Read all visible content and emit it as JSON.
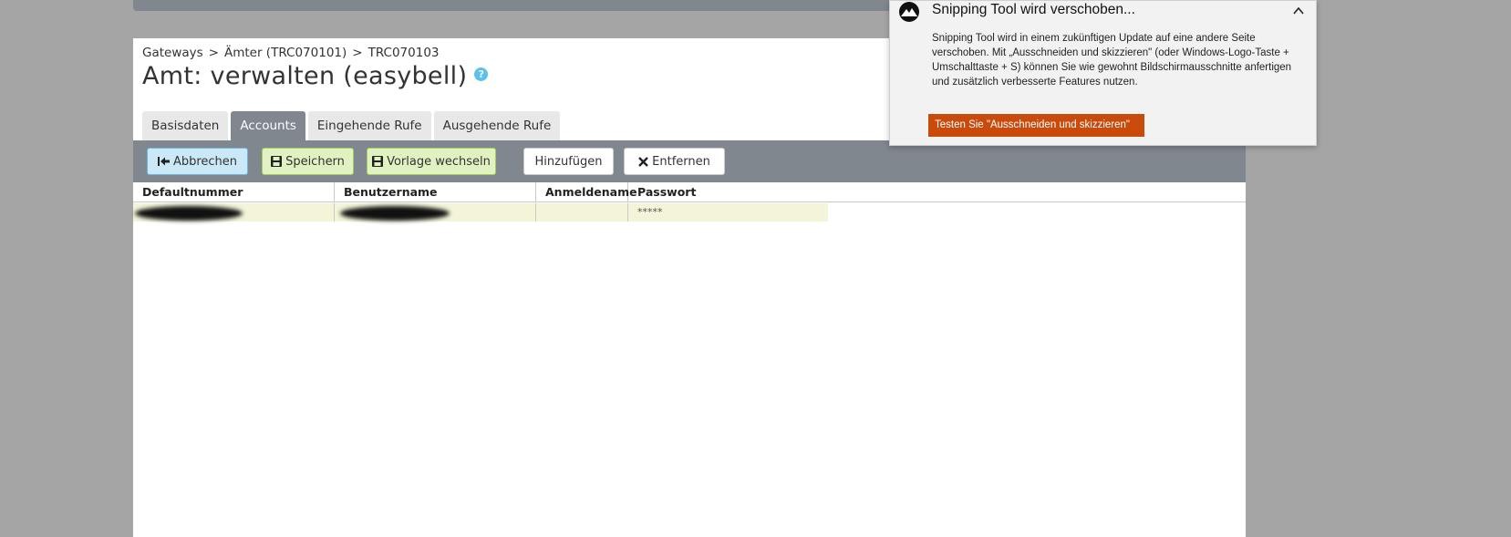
{
  "breadcrumb": {
    "items": [
      "Gateways",
      "Ämter (TRC070101)",
      "TRC070103"
    ],
    "separator": ">"
  },
  "page": {
    "title": "Amt: verwalten (easybell)",
    "help_glyph": "?"
  },
  "tabs": [
    {
      "label": "Basisdaten",
      "active": false
    },
    {
      "label": "Accounts",
      "active": true
    },
    {
      "label": "Eingehende Rufe",
      "active": false
    },
    {
      "label": "Ausgehende Rufe",
      "active": false
    }
  ],
  "toolbar": {
    "cancel_label": "Abbrechen",
    "save_label": "Speichern",
    "switch_template_label": "Vorlage wechseln",
    "add_label": "Hinzufügen",
    "remove_label": "Entfernen"
  },
  "table": {
    "columns": [
      "Defaultnummer",
      "Benutzername",
      "Anmeldename",
      "Passwort"
    ],
    "rows": [
      {
        "defaultnummer": "[redacted]",
        "benutzername": "[redacted]",
        "anmeldename": "",
        "passwort": "*****"
      }
    ]
  },
  "notification": {
    "title": "Snipping Tool wird verschoben...",
    "body": "Snipping Tool wird in einem zukünftigen Update auf eine andere Seite verschoben. Mit „Ausschneiden und skizzieren\" (oder Windows-Logo-Taste  + Umschalttaste  + S) können Sie wie gewohnt Bildschirmausschnitte anfertigen und zusätzlich verbesserte Features nutzen.",
    "action_label": "Testen Sie \"Ausschneiden und skizzieren\""
  },
  "colors": {
    "toolbar_bg": "#80878e",
    "row_bg": "#f4f4d9",
    "notification_action_bg": "#c84b0c",
    "help_icon": "#5bc0eb"
  },
  "icons": {
    "cancel": "arrow-to-left-icon",
    "save": "floppy-disk-icon",
    "switch_template": "floppy-disk-icon",
    "remove": "close-icon",
    "notification_app": "snipping-tool-icon",
    "collapse": "chevron-up-icon",
    "help": "question-circle-icon"
  }
}
